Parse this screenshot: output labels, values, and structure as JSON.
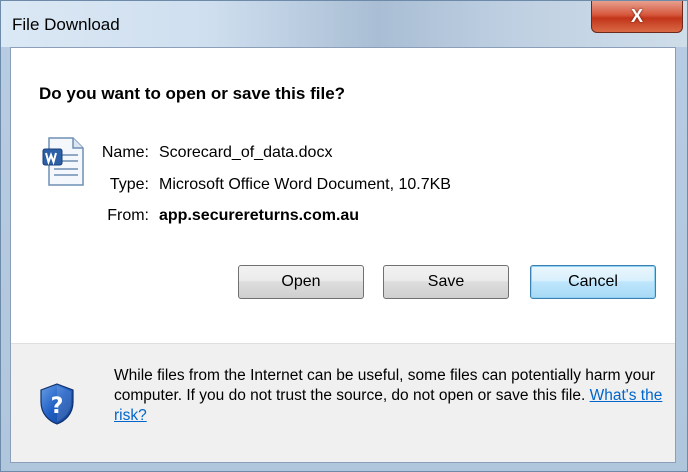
{
  "window": {
    "title": "File Download",
    "close_glyph": "X"
  },
  "dialog": {
    "heading": "Do you want to open or save this file?",
    "file_icon": "word-document-icon",
    "fields": {
      "name_label": "Name:",
      "name_value": "Scorecard_of_data.docx",
      "type_label": "Type:",
      "type_value": "Microsoft Office Word Document, 10.7KB",
      "from_label": "From:",
      "from_value": "app.securereturns.com.au"
    },
    "buttons": {
      "open": "Open",
      "save": "Save",
      "cancel": "Cancel"
    }
  },
  "footer": {
    "icon": "security-shield-question-icon",
    "warning_text": "While files from the Internet can be useful, some files can potentially harm your computer. If you do not trust the source, do not open or save this file.",
    "risk_link": "What's the risk?"
  },
  "colors": {
    "link": "#0066cc",
    "close_button": "#c2341a",
    "default_button_border": "#3c7fb1"
  }
}
